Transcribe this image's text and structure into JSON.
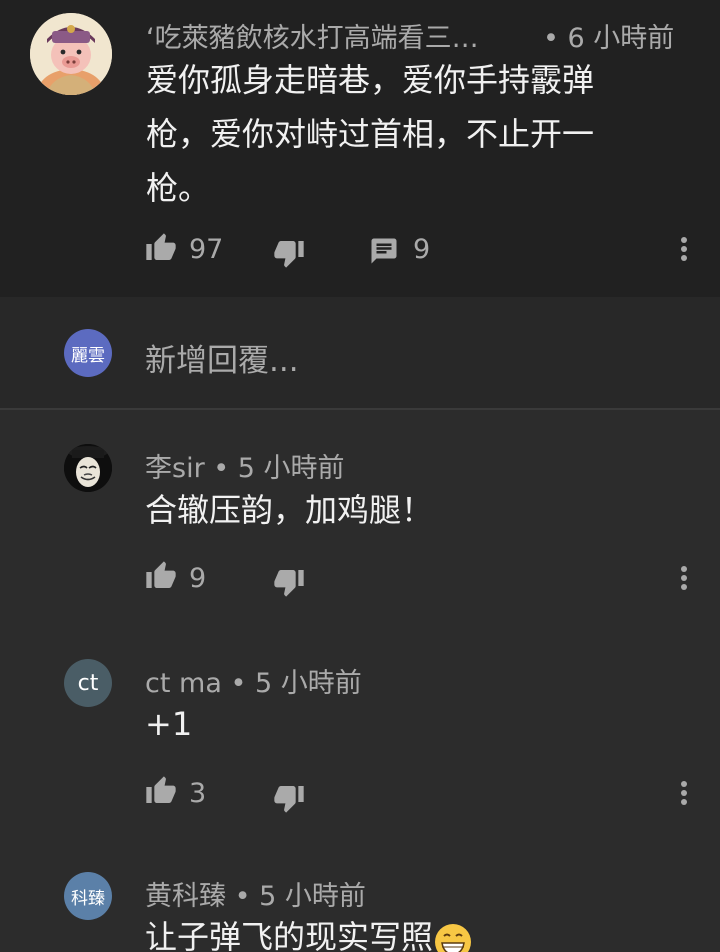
{
  "main_comment": {
    "author": "‘吃萊豬飲核水打高端看三…",
    "time": "• 6 小時前",
    "text_lines": [
      "爱你孤身走暗巷，爱你手持霰弹",
      "枪，爱你对峙过首相，不止开一",
      "枪。"
    ],
    "likes": "97",
    "replies": "9"
  },
  "reply_input": {
    "avatar_text": "麗雲",
    "avatar_color": "#5c6bc0",
    "placeholder": "新增回覆..."
  },
  "replies": [
    {
      "author": "李sir",
      "time": "• 5 小時前",
      "text": "合辙压韵，加鸡腿！",
      "likes": "9"
    },
    {
      "author": "ct ma",
      "time": "• 5 小時前",
      "text": "+1",
      "likes": "3",
      "avatar_text": "ct",
      "avatar_color": "#4a5d66"
    },
    {
      "author": "黄科臻",
      "time": "• 5 小時前",
      "text": "让子弹飞的现实写照",
      "avatar_text": "科臻",
      "avatar_color": "#5b80a8"
    }
  ],
  "icons": {
    "like": "thumbs-up-icon",
    "dislike": "thumbs-down-icon",
    "reply": "comment-icon",
    "more": "more-vert-icon"
  }
}
